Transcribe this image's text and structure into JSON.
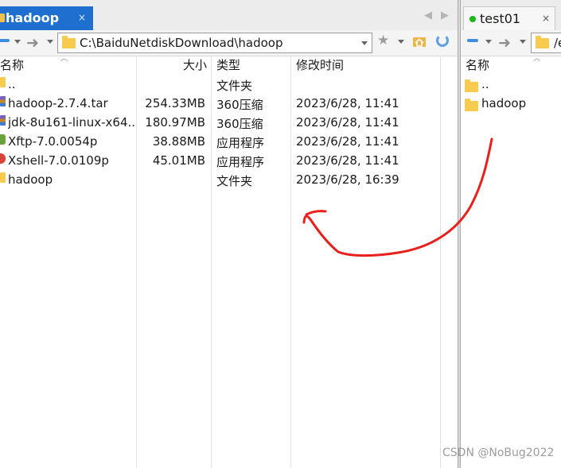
{
  "left_pane": {
    "tab": {
      "label": "hadoop",
      "close": "×"
    },
    "nav_prev": "◀",
    "nav_next": "▶",
    "toolbar": {
      "forward": "➜",
      "bookmark": "★"
    },
    "address_path": "C:\\BaiduNetdiskDownload\\hadoop",
    "columns": {
      "name": "名称",
      "size": "大小",
      "type": "类型",
      "modified": "修改时间"
    },
    "rows": [
      {
        "name": "..",
        "size": "",
        "type": "文件夹",
        "modified": "",
        "icon": "folder-icon",
        "color": "#f6cb4e"
      },
      {
        "name": "hadoop-2.7.4.tar",
        "size": "254.33MB",
        "type": "360压缩",
        "modified": "2023/6/28, 11:41",
        "icon": "archive-icon",
        "color": "#c9891f"
      },
      {
        "name": "jdk-8u161-linux-x64...",
        "size": "180.97MB",
        "type": "360压缩",
        "modified": "2023/6/28, 11:41",
        "icon": "archive-icon",
        "color": "#c9891f"
      },
      {
        "name": "Xftp-7.0.0054p",
        "size": "38.88MB",
        "type": "应用程序",
        "modified": "2023/6/28, 11:41",
        "icon": "installer-icon",
        "color": "#6aa33c"
      },
      {
        "name": "Xshell-7.0.0109p",
        "size": "45.01MB",
        "type": "应用程序",
        "modified": "2023/6/28, 11:41",
        "icon": "installer-icon",
        "color": "#d9453b"
      },
      {
        "name": "hadoop",
        "size": "",
        "type": "文件夹",
        "modified": "2023/6/28, 16:39",
        "icon": "folder-icon",
        "color": "#f6cb4e"
      }
    ]
  },
  "right_pane": {
    "tab": {
      "label": "test01",
      "close": "×",
      "status_color": "#16b916"
    },
    "address_path": "/e",
    "columns": {
      "name": "名称"
    },
    "rows": [
      {
        "name": ".."
      },
      {
        "name": "hadoop"
      }
    ]
  },
  "annotation": {
    "arrow_color": "#e8201c"
  },
  "watermark": "CSDN @NoBug2022",
  "colors": {
    "accent": "#1e6fd0",
    "folder": "#f6cb4e"
  }
}
